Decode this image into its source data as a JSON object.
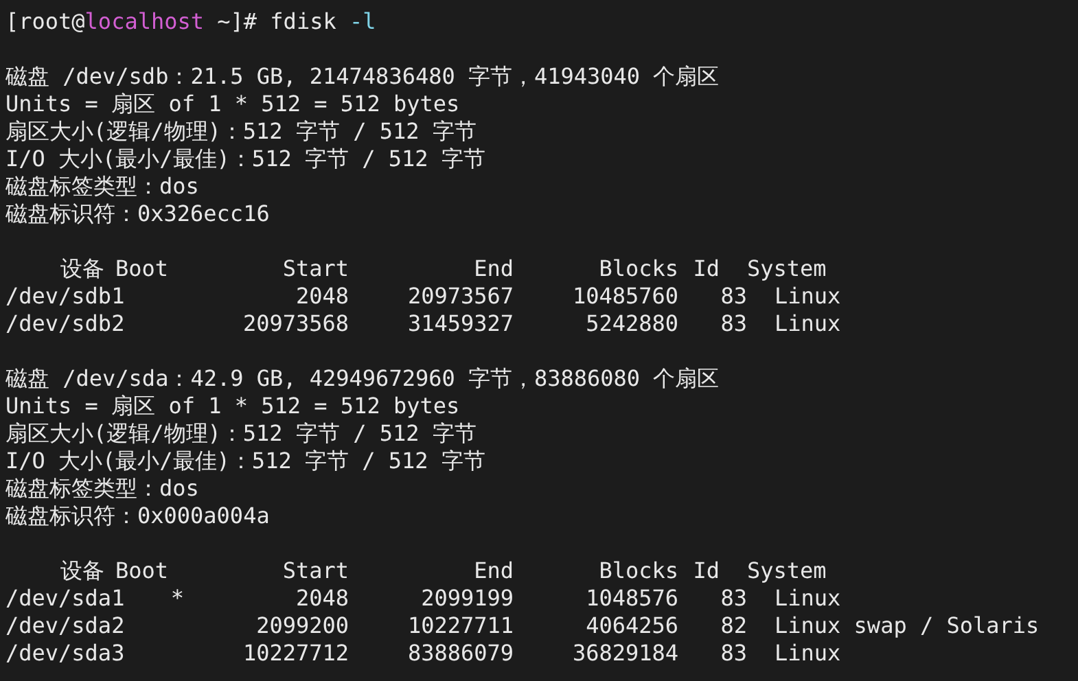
{
  "prompt": {
    "user": "[root@",
    "host": "localhost",
    "path": " ~]#",
    "command": "fdisk",
    "option": "-l"
  },
  "disks": [
    {
      "info_lines": [
        "磁盘 /dev/sdb：21.5 GB, 21474836480 字节，41943040 个扇区",
        "Units = 扇区 of 1 * 512 = 512 bytes",
        "扇区大小(逻辑/物理)：512 字节 / 512 字节",
        "I/O 大小(最小/最佳)：512 字节 / 512 字节",
        "磁盘标签类型：dos",
        "磁盘标识符：0x326ecc16"
      ],
      "columns": [
        "设备",
        "Boot",
        "Start",
        "End",
        "Blocks",
        "Id",
        "System"
      ],
      "rows": [
        {
          "device": "/dev/sdb1",
          "boot": "",
          "start": "2048",
          "end": "20973567",
          "blocks": "10485760",
          "id": "83",
          "system": "Linux"
        },
        {
          "device": "/dev/sdb2",
          "boot": "",
          "start": "20973568",
          "end": "31459327",
          "blocks": "5242880",
          "id": "83",
          "system": "Linux"
        }
      ]
    },
    {
      "info_lines": [
        "磁盘 /dev/sda：42.9 GB, 42949672960 字节，83886080 个扇区",
        "Units = 扇区 of 1 * 512 = 512 bytes",
        "扇区大小(逻辑/物理)：512 字节 / 512 字节",
        "I/O 大小(最小/最佳)：512 字节 / 512 字节",
        "磁盘标签类型：dos",
        "磁盘标识符：0x000a004a"
      ],
      "columns": [
        "设备",
        "Boot",
        "Start",
        "End",
        "Blocks",
        "Id",
        "System"
      ],
      "rows": [
        {
          "device": "/dev/sda1",
          "boot": "*",
          "start": "2048",
          "end": "2099199",
          "blocks": "1048576",
          "id": "83",
          "system": "Linux"
        },
        {
          "device": "/dev/sda2",
          "boot": "",
          "start": "2099200",
          "end": "10227711",
          "blocks": "4064256",
          "id": "82",
          "system": "Linux swap / Solaris"
        },
        {
          "device": "/dev/sda3",
          "boot": "",
          "start": "10227712",
          "end": "83886079",
          "blocks": "36829184",
          "id": "83",
          "system": "Linux"
        }
      ]
    }
  ]
}
